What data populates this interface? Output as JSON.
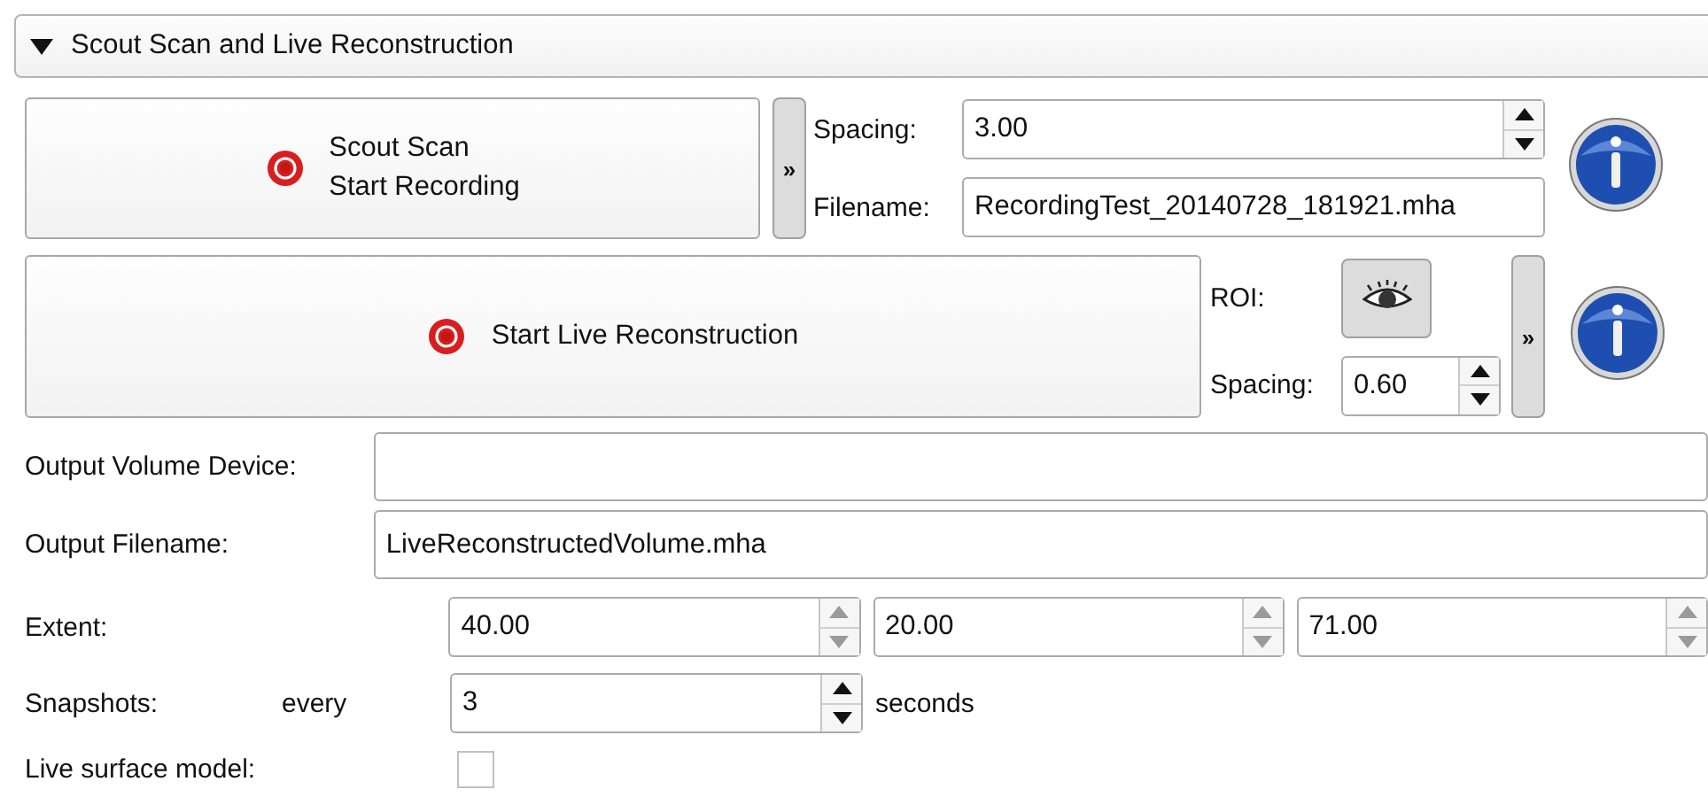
{
  "section": {
    "title": "Scout Scan and Live Reconstruction",
    "expanded": true
  },
  "scout": {
    "button_lines": [
      "Scout Scan",
      "Start Recording"
    ],
    "expand_label": "»",
    "spacing_label": "Spacing:",
    "spacing_value": "3.00",
    "filename_label": "Filename:",
    "filename_value": "RecordingTest_20140728_181921.mha"
  },
  "live": {
    "button_label": "Start Live Reconstruction",
    "roi_label": "ROI:",
    "spacing_label": "Spacing:",
    "spacing_value": "0.60",
    "expand_label": "»"
  },
  "output_volume_device": {
    "label": "Output Volume Device:"
  },
  "output_filename": {
    "label": "Output Filename:",
    "value": "LiveReconstructedVolume.mha"
  },
  "extent": {
    "label": "Extent:",
    "values": [
      "40.00",
      "20.00",
      "71.00"
    ]
  },
  "snapshots": {
    "label": "Snapshots:",
    "prefix": "every",
    "value": "3",
    "suffix": "seconds"
  },
  "live_surface_model": {
    "label": "Live surface model:",
    "checked": false
  }
}
